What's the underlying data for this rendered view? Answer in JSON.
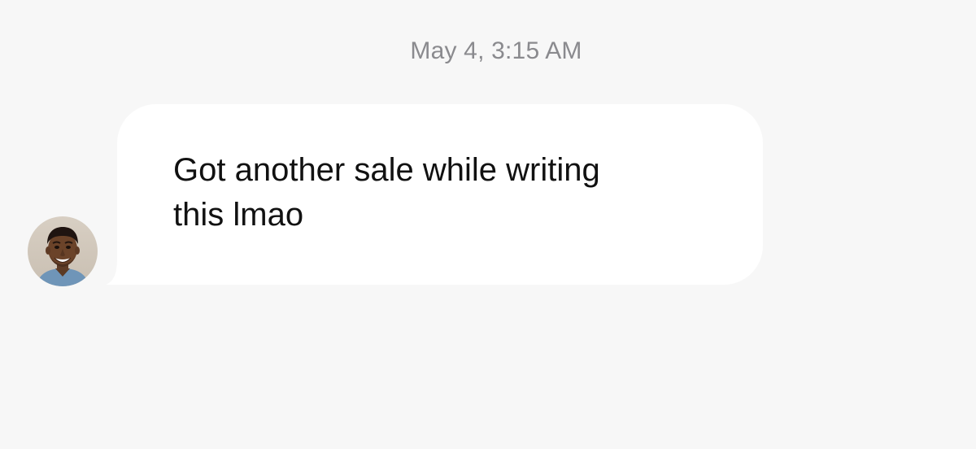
{
  "conversation": {
    "timestamp": "May 4, 3:15 AM",
    "messages": [
      {
        "direction": "incoming",
        "sender_avatar": "person-avatar",
        "text": "Got another sale while writing this lmao"
      }
    ]
  },
  "colors": {
    "background": "#f7f7f7",
    "bubble": "#ffffff",
    "timestamp": "#8a8a8e",
    "message_text": "#111111"
  }
}
